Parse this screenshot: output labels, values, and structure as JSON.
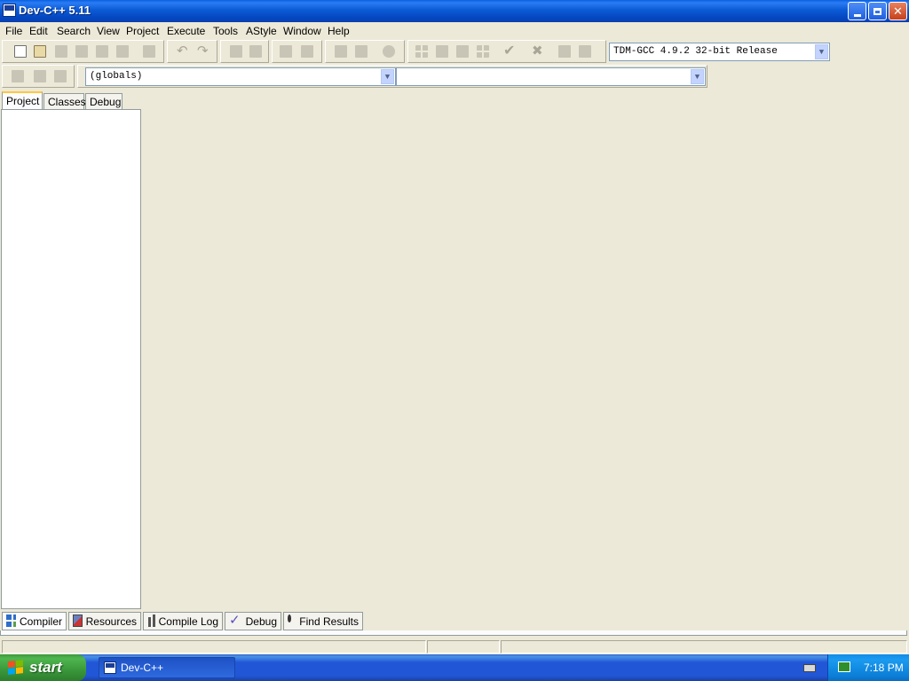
{
  "window": {
    "title": "Dev-C++ 5.11",
    "controls": [
      "minimize",
      "restore",
      "close"
    ]
  },
  "menu": [
    "File",
    "Edit",
    "Search",
    "View",
    "Project",
    "Execute",
    "Tools",
    "AStyle",
    "Window",
    "Help"
  ],
  "toolbar": {
    "compiler_select": "TDM-GCC 4.9.2 32-bit Release",
    "scope_select": "(globals)",
    "member_select": ""
  },
  "left_panel": {
    "tabs": [
      "Project",
      "Classes",
      "Debug"
    ],
    "active_tab": "Project"
  },
  "bottom_panel": {
    "tabs": [
      "Compiler",
      "Resources",
      "Compile Log",
      "Debug",
      "Find Results"
    ]
  },
  "taskbar": {
    "start_label": "start",
    "task_label": "Dev-C++",
    "clock": "7:18 PM"
  },
  "colors": {
    "face": "#ECE9D8",
    "titlebar_blue": "#0B5BD6",
    "start_green": "#3A973A",
    "tab_highlight": "#FFC83C"
  }
}
